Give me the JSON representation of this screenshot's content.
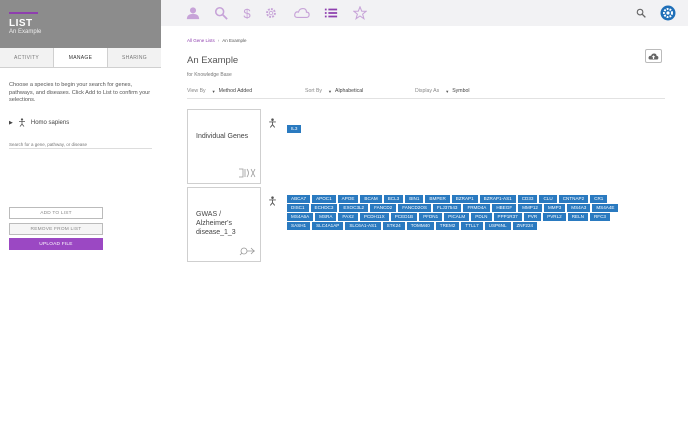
{
  "panel": {
    "title": "LIST",
    "subtitle": "An Example",
    "tabs": [
      {
        "label": "ACTIVITY",
        "active": false
      },
      {
        "label": "MANAGE",
        "active": true
      },
      {
        "label": "SHARING",
        "active": false
      }
    ],
    "intro": "Choose a species to begin your search for genes, pathways, and diseases. Click Add to List to confirm your selections.",
    "species": "Homo sapiens",
    "search_placeholder": "Search for a gene, pathway, or disease",
    "add_label": "ADD TO LIST",
    "remove_label": "REMOVE FROM LIST",
    "upload_label": "UPLOAD FILE"
  },
  "topbar": {
    "icons": [
      "person-icon",
      "search-icon",
      "dollar-icon",
      "gear-icon",
      "cloud-icon",
      "list-icon",
      "star-icon"
    ],
    "active_icon": "list-icon",
    "accent_color": "#8e3fae",
    "icon_color": "#c7a3d8"
  },
  "main": {
    "breadcrumb": [
      "All Gene Lists",
      "An Example"
    ],
    "title": "An Example",
    "subtitle": "for Knowledge Base",
    "view_by": {
      "label": "View By",
      "value": "Method Added"
    },
    "sort_by": {
      "label": "Sort By",
      "value": "Alphabetical"
    },
    "display_as": {
      "label": "Display As",
      "value": "Symbol"
    },
    "groups": [
      {
        "title": "Individual Genes",
        "genes": [
          "IL3"
        ]
      },
      {
        "title": "GWAS / Alzheimer's disease_1_3",
        "genes": [
          "ABCA7",
          "APOC1",
          "APOE",
          "BCAM",
          "BCL3",
          "BIN1",
          "BMPER",
          "BZRAP1",
          "BZRAP1-AS1",
          "CD33",
          "CLU",
          "CNTNAP2",
          "CR1",
          "DISC1",
          "ECHDC3",
          "EXOC3L2",
          "FANCD2",
          "FANCD2OS",
          "FLJ37543",
          "FRMD4A",
          "HBEGF",
          "MMP12",
          "MMP3",
          "MS4A3",
          "MS4A4E",
          "MS4A6A",
          "MSRA",
          "PAX2",
          "PCDH11X",
          "PCED1B",
          "PFDN1",
          "PICALM",
          "PDLN",
          "PPP1R37",
          "PVR",
          "PVRL2",
          "RELN",
          "RFC3",
          "SASH1",
          "SLC4A1AP",
          "SLC6A1-AS1",
          "STK24",
          "TOMM40",
          "TREM2",
          "TTLL7",
          "USP6NL",
          "ZNF224"
        ]
      }
    ],
    "chip_color": "#2a7ac0",
    "upload_color": "#9b48c3"
  }
}
